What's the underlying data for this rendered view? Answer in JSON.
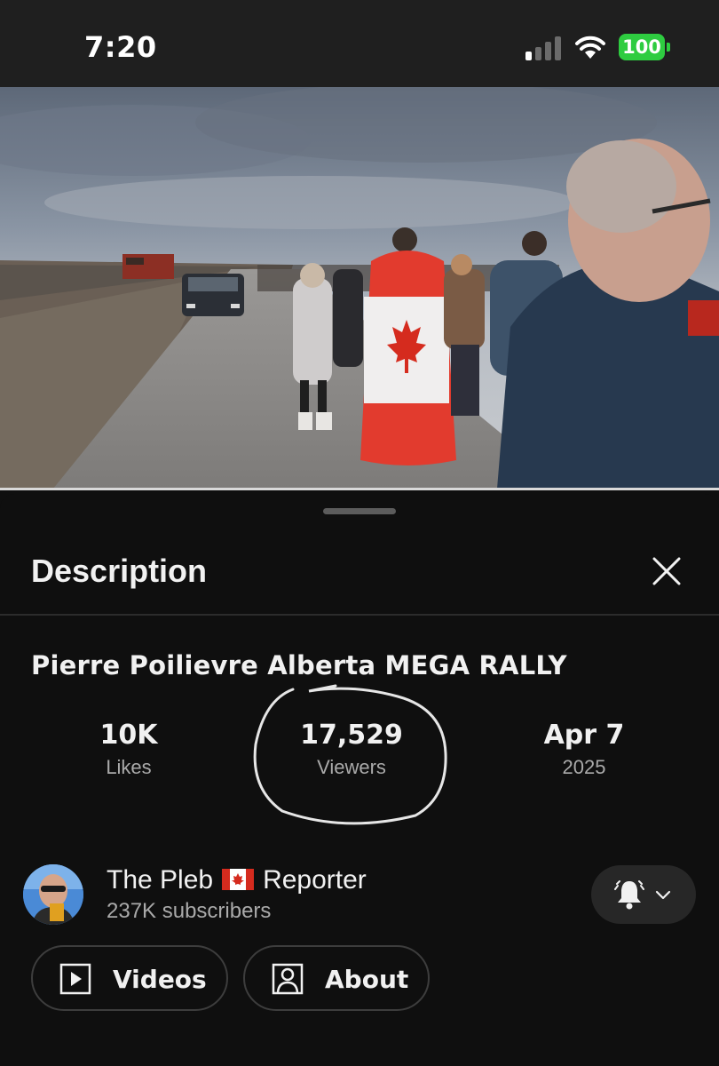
{
  "status_bar": {
    "time": "7:20",
    "battery": "100",
    "battery_color": "#2ecc40",
    "icons": [
      "cellular-signal-icon",
      "wifi-icon",
      "battery-icon"
    ]
  },
  "video": {
    "description": "video-thumbnail"
  },
  "sheet": {
    "title": "Description",
    "close_icon": "close-icon"
  },
  "video_info": {
    "title": "Pierre Poilievre Alberta MEGA RALLY",
    "stats": [
      {
        "value": "10K",
        "label": "Likes"
      },
      {
        "value": "17,529",
        "label": "Viewers"
      },
      {
        "value": "Apr 7",
        "label": "2025"
      }
    ]
  },
  "channel": {
    "name_part1": "The Pleb",
    "flag_icon": "canada-flag-icon",
    "name_part2": "Reporter",
    "subscribers": "237K subscribers",
    "notification_icon": "bell-icon"
  },
  "buttons": {
    "videos_label": "Videos",
    "about_label": "About"
  },
  "colors": {
    "background": "#0f0f0f",
    "secondary_text": "#aaaaaa",
    "flag_red": "#d52b1e"
  }
}
